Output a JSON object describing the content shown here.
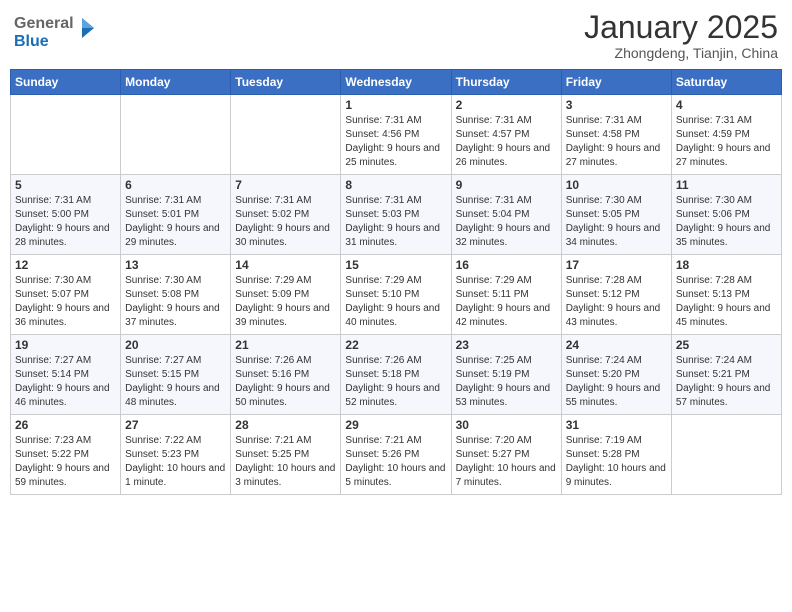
{
  "logo": {
    "general": "General",
    "blue": "Blue"
  },
  "header": {
    "month": "January 2025",
    "location": "Zhongdeng, Tianjin, China"
  },
  "weekdays": [
    "Sunday",
    "Monday",
    "Tuesday",
    "Wednesday",
    "Thursday",
    "Friday",
    "Saturday"
  ],
  "weeks": [
    [
      {
        "day": "",
        "info": ""
      },
      {
        "day": "",
        "info": ""
      },
      {
        "day": "",
        "info": ""
      },
      {
        "day": "1",
        "info": "Sunrise: 7:31 AM\nSunset: 4:56 PM\nDaylight: 9 hours and 25 minutes."
      },
      {
        "day": "2",
        "info": "Sunrise: 7:31 AM\nSunset: 4:57 PM\nDaylight: 9 hours and 26 minutes."
      },
      {
        "day": "3",
        "info": "Sunrise: 7:31 AM\nSunset: 4:58 PM\nDaylight: 9 hours and 27 minutes."
      },
      {
        "day": "4",
        "info": "Sunrise: 7:31 AM\nSunset: 4:59 PM\nDaylight: 9 hours and 27 minutes."
      }
    ],
    [
      {
        "day": "5",
        "info": "Sunrise: 7:31 AM\nSunset: 5:00 PM\nDaylight: 9 hours and 28 minutes."
      },
      {
        "day": "6",
        "info": "Sunrise: 7:31 AM\nSunset: 5:01 PM\nDaylight: 9 hours and 29 minutes."
      },
      {
        "day": "7",
        "info": "Sunrise: 7:31 AM\nSunset: 5:02 PM\nDaylight: 9 hours and 30 minutes."
      },
      {
        "day": "8",
        "info": "Sunrise: 7:31 AM\nSunset: 5:03 PM\nDaylight: 9 hours and 31 minutes."
      },
      {
        "day": "9",
        "info": "Sunrise: 7:31 AM\nSunset: 5:04 PM\nDaylight: 9 hours and 32 minutes."
      },
      {
        "day": "10",
        "info": "Sunrise: 7:30 AM\nSunset: 5:05 PM\nDaylight: 9 hours and 34 minutes."
      },
      {
        "day": "11",
        "info": "Sunrise: 7:30 AM\nSunset: 5:06 PM\nDaylight: 9 hours and 35 minutes."
      }
    ],
    [
      {
        "day": "12",
        "info": "Sunrise: 7:30 AM\nSunset: 5:07 PM\nDaylight: 9 hours and 36 minutes."
      },
      {
        "day": "13",
        "info": "Sunrise: 7:30 AM\nSunset: 5:08 PM\nDaylight: 9 hours and 37 minutes."
      },
      {
        "day": "14",
        "info": "Sunrise: 7:29 AM\nSunset: 5:09 PM\nDaylight: 9 hours and 39 minutes."
      },
      {
        "day": "15",
        "info": "Sunrise: 7:29 AM\nSunset: 5:10 PM\nDaylight: 9 hours and 40 minutes."
      },
      {
        "day": "16",
        "info": "Sunrise: 7:29 AM\nSunset: 5:11 PM\nDaylight: 9 hours and 42 minutes."
      },
      {
        "day": "17",
        "info": "Sunrise: 7:28 AM\nSunset: 5:12 PM\nDaylight: 9 hours and 43 minutes."
      },
      {
        "day": "18",
        "info": "Sunrise: 7:28 AM\nSunset: 5:13 PM\nDaylight: 9 hours and 45 minutes."
      }
    ],
    [
      {
        "day": "19",
        "info": "Sunrise: 7:27 AM\nSunset: 5:14 PM\nDaylight: 9 hours and 46 minutes."
      },
      {
        "day": "20",
        "info": "Sunrise: 7:27 AM\nSunset: 5:15 PM\nDaylight: 9 hours and 48 minutes."
      },
      {
        "day": "21",
        "info": "Sunrise: 7:26 AM\nSunset: 5:16 PM\nDaylight: 9 hours and 50 minutes."
      },
      {
        "day": "22",
        "info": "Sunrise: 7:26 AM\nSunset: 5:18 PM\nDaylight: 9 hours and 52 minutes."
      },
      {
        "day": "23",
        "info": "Sunrise: 7:25 AM\nSunset: 5:19 PM\nDaylight: 9 hours and 53 minutes."
      },
      {
        "day": "24",
        "info": "Sunrise: 7:24 AM\nSunset: 5:20 PM\nDaylight: 9 hours and 55 minutes."
      },
      {
        "day": "25",
        "info": "Sunrise: 7:24 AM\nSunset: 5:21 PM\nDaylight: 9 hours and 57 minutes."
      }
    ],
    [
      {
        "day": "26",
        "info": "Sunrise: 7:23 AM\nSunset: 5:22 PM\nDaylight: 9 hours and 59 minutes."
      },
      {
        "day": "27",
        "info": "Sunrise: 7:22 AM\nSunset: 5:23 PM\nDaylight: 10 hours and 1 minute."
      },
      {
        "day": "28",
        "info": "Sunrise: 7:21 AM\nSunset: 5:25 PM\nDaylight: 10 hours and 3 minutes."
      },
      {
        "day": "29",
        "info": "Sunrise: 7:21 AM\nSunset: 5:26 PM\nDaylight: 10 hours and 5 minutes."
      },
      {
        "day": "30",
        "info": "Sunrise: 7:20 AM\nSunset: 5:27 PM\nDaylight: 10 hours and 7 minutes."
      },
      {
        "day": "31",
        "info": "Sunrise: 7:19 AM\nSunset: 5:28 PM\nDaylight: 10 hours and 9 minutes."
      },
      {
        "day": "",
        "info": ""
      }
    ]
  ]
}
